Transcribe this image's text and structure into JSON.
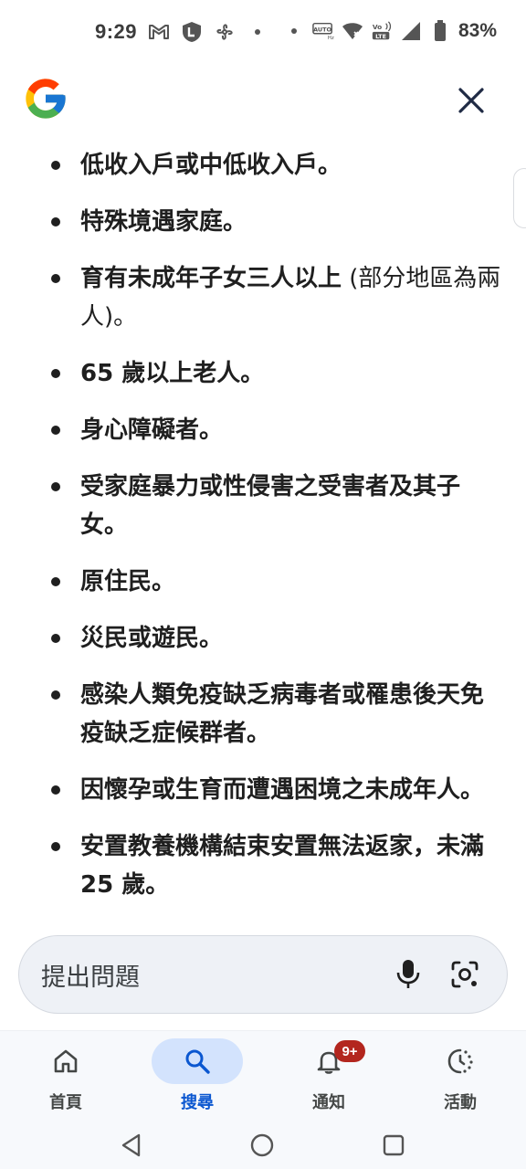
{
  "status_bar": {
    "time": "9:29",
    "battery": "83%",
    "left_icons": [
      "gmail-icon",
      "shield-l-icon",
      "fan-icon",
      "dot-icon"
    ],
    "right_icons": [
      "dot-icon",
      "auto-hd-icon",
      "wifi-icon",
      "volte-icon",
      "signal-icon",
      "battery-icon"
    ]
  },
  "header": {
    "logo": "google-g-logo",
    "close_icon": "close-icon"
  },
  "list": {
    "items": [
      {
        "text": "低收入戶或中低收入戶。",
        "suffix": ""
      },
      {
        "text": "特殊境遇家庭。",
        "suffix": ""
      },
      {
        "text": "育有未成年子女三人以上",
        "suffix": " (部分地區為兩人)。"
      },
      {
        "text": "65 歲以上老人。",
        "suffix": ""
      },
      {
        "text": "身心障礙者。",
        "suffix": ""
      },
      {
        "text": "受家庭暴力或性侵害之受害者及其子女。",
        "suffix": ""
      },
      {
        "text": "原住民。",
        "suffix": ""
      },
      {
        "text": "災民或遊民。",
        "suffix": ""
      },
      {
        "text": "感染人類免疫缺乏病毒者或罹患後天免疫缺乏症候群者。",
        "suffix": ""
      },
      {
        "text": "因懷孕或生育而遭遇困境之未成年人。",
        "suffix": ""
      },
      {
        "text": "安置教養機構結束安置無法返家，未滿 25 歲。",
        "suffix": ""
      }
    ]
  },
  "ask_bar": {
    "placeholder": "提出問題",
    "mic_icon": "microphone-icon",
    "lens_icon": "lens-camera-icon"
  },
  "bottom_nav": {
    "items": [
      {
        "label": "首頁",
        "icon": "home-icon",
        "active": false
      },
      {
        "label": "搜尋",
        "icon": "search-icon",
        "active": true
      },
      {
        "label": "通知",
        "icon": "bell-icon",
        "active": false,
        "badge": "9+"
      },
      {
        "label": "活動",
        "icon": "activity-history-icon",
        "active": false
      }
    ]
  },
  "colors": {
    "accent": "#0b57d0",
    "active_pill": "#d3e3fd",
    "badge": "#b3261e",
    "text": "#1f1f1f"
  }
}
